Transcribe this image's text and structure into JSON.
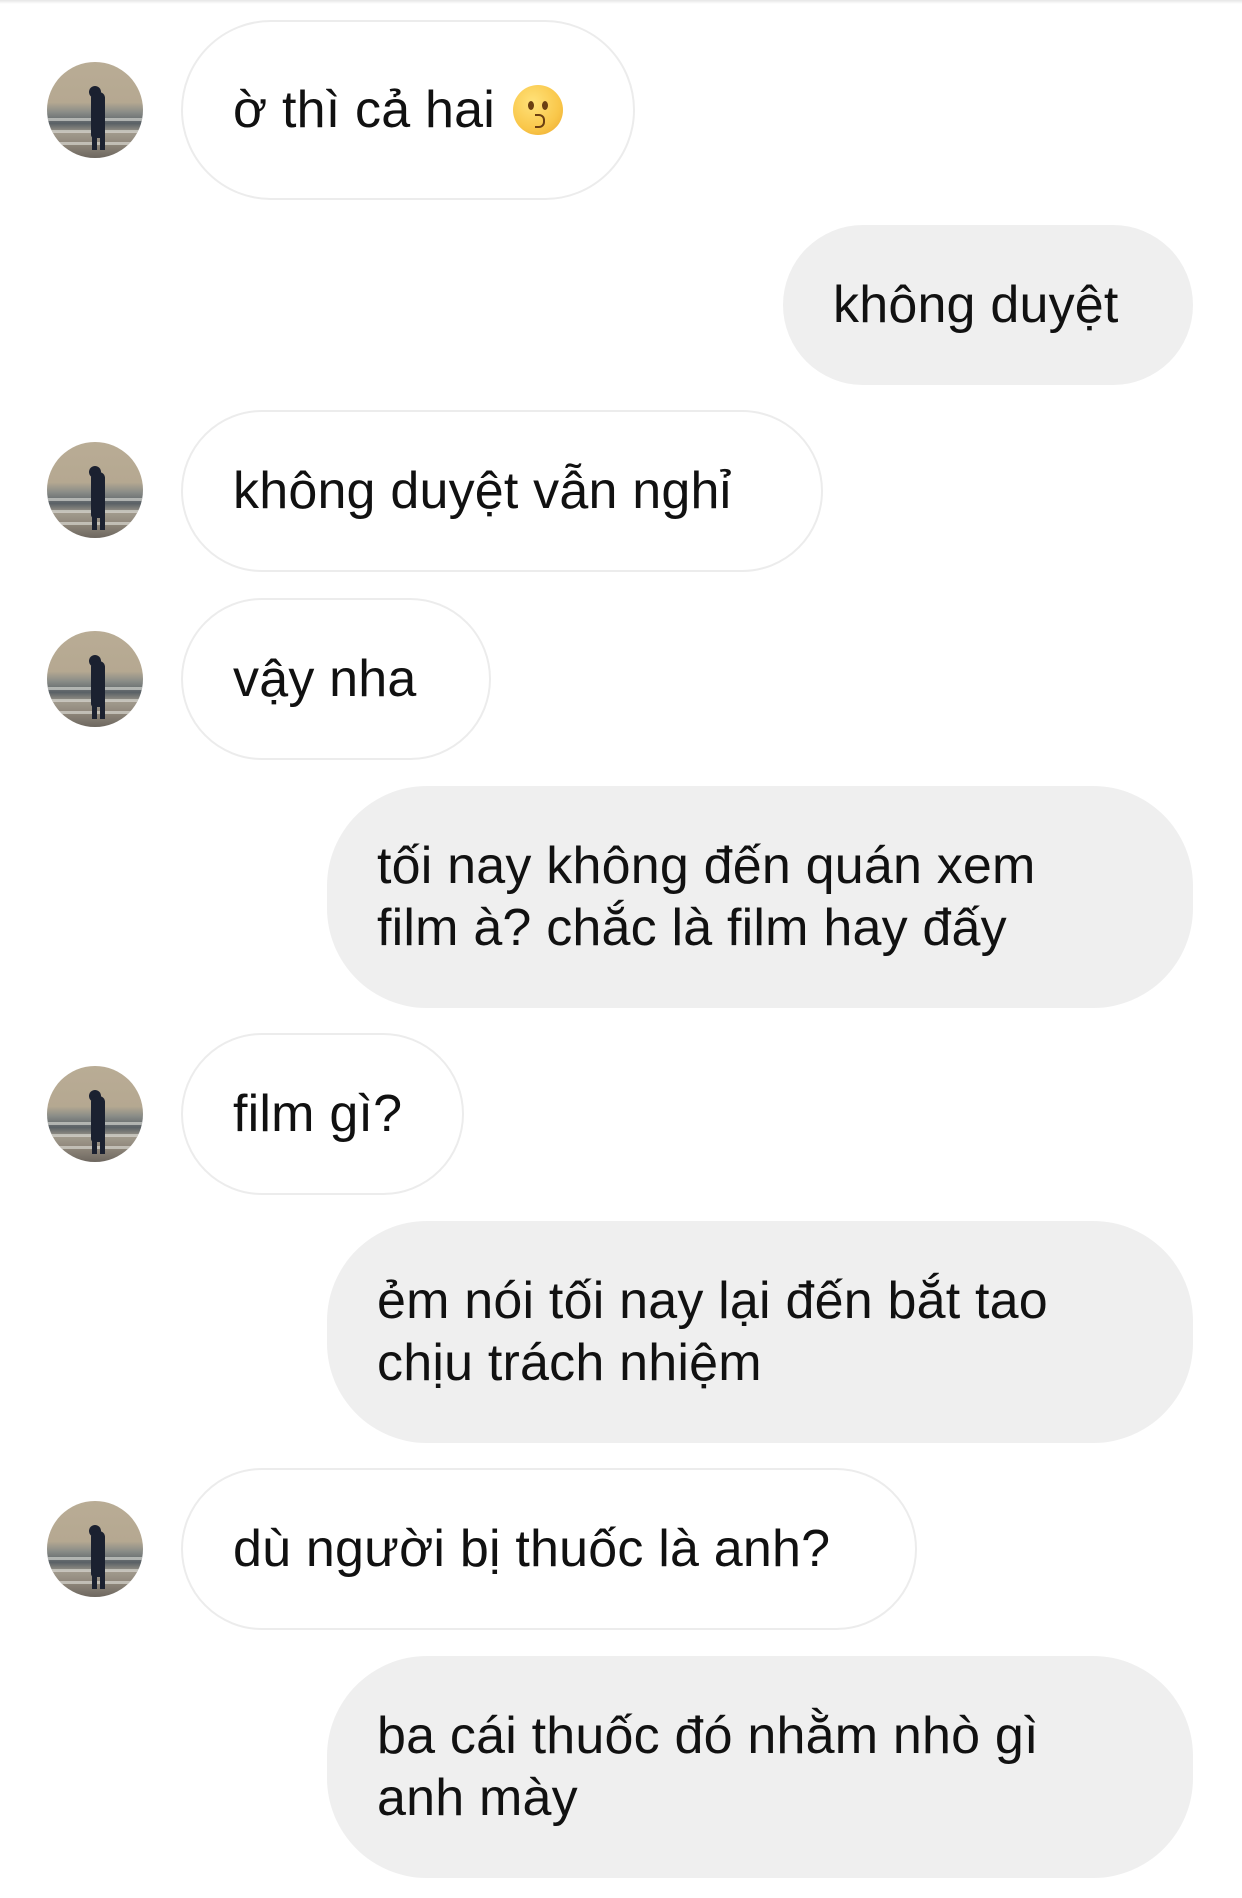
{
  "conversation": {
    "messages": [
      {
        "side": "in",
        "text": "ờ thì cả hai",
        "emoji": "face-kissing-icon"
      },
      {
        "side": "out",
        "text": "không duyệt"
      },
      {
        "side": "in",
        "text": "không duyệt vẫn nghỉ"
      },
      {
        "side": "in",
        "text": "vậy nha"
      },
      {
        "side": "out",
        "lines": [
          "tối nay không đến quán xem",
          "film à? chắc là film hay đấy"
        ]
      },
      {
        "side": "in",
        "text": "film gì?"
      },
      {
        "side": "out",
        "lines": [
          "ẻm nói tối nay lại đến bắt tao",
          "chịu trách nhiệm"
        ]
      },
      {
        "side": "in",
        "text": "dù người bị thuốc là anh?"
      },
      {
        "side": "out",
        "lines": [
          "ba cái thuốc đó nhằm nhò gì",
          "anh mày"
        ]
      }
    ]
  },
  "colors": {
    "incoming_bubble": "#ffffff",
    "incoming_border": "#ececec",
    "outgoing_bubble": "#efefef",
    "text": "#111111"
  }
}
